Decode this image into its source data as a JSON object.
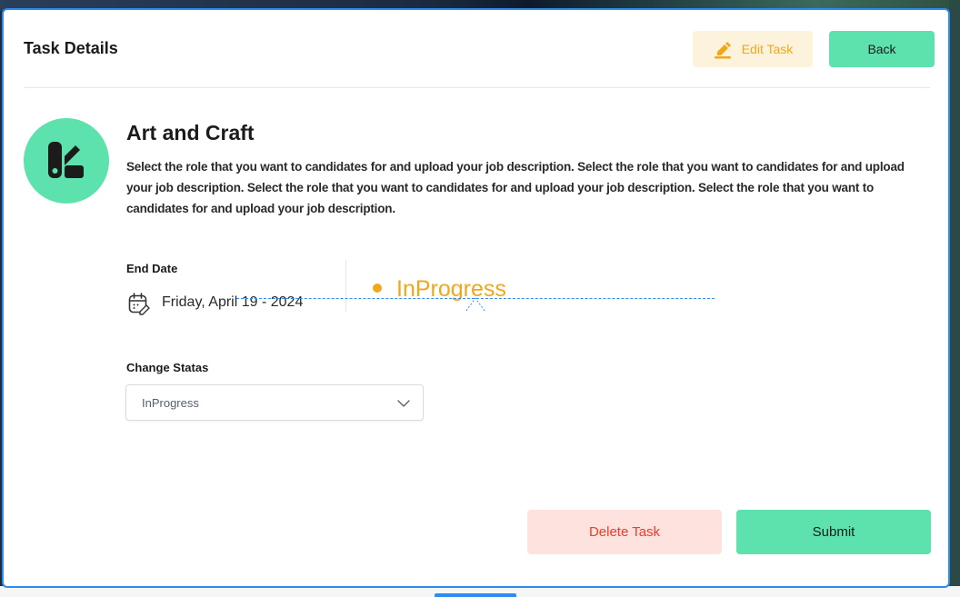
{
  "modal": {
    "title": "Task Details"
  },
  "header": {
    "edit_label": "Edit Task",
    "back_label": "Back"
  },
  "task": {
    "name": "Art and Craft",
    "description": "Select the role that you want to candidates for and upload your job description. Select the role that you want to candidates for and upload your job description. Select the role that you want to candidates for and upload your job description. Select the role that you want to candidates for and upload your job description.",
    "end_date_label": "End Date",
    "end_date_value": "Friday, April 19 - 2024",
    "status": "InProgress"
  },
  "change_status": {
    "label": "Change Statas",
    "selected": "InProgress"
  },
  "footer": {
    "delete_label": "Delete Task",
    "submit_label": "Submit"
  },
  "colors": {
    "accent_green": "#5de1ad",
    "status_orange": "#f0a81a",
    "danger_red": "#ef3a2c",
    "selection_blue": "#2d8cf0"
  },
  "icons": {
    "edit": "pencil-icon",
    "logo": "app-logo-icon",
    "calendar": "calendar-edit-icon",
    "chevron": "chevron-down-icon"
  }
}
